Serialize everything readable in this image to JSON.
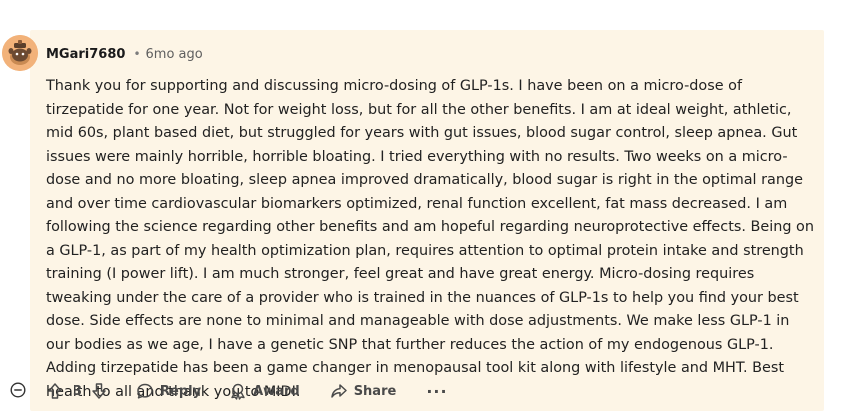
{
  "comment": {
    "username": "MGari7680",
    "separator": "•",
    "timestamp": "6mo ago",
    "body": "Thank you for supporting and discussing micro-dosing of GLP-1s. I have been on a micro-dose of tirzepatide for one year. Not for weight loss, but for all the other benefits. I am at ideal weight, athletic, mid 60s, plant based diet, but struggled for years with gut issues, blood sugar control, sleep apnea. Gut issues were mainly horrible, horrible bloating. I tried everything with no results. Two weeks on a micro-dose and no more bloating, sleep apnea improved dramatically, blood sugar is right in the optimal range and over time cardiovascular biomarkers optimized, renal function excellent, fat mass decreased. I am following the science regarding other benefits and am hopeful regarding neuroprotective effects. Being on a GLP-1, as part of my health optimization plan, requires attention to optimal protein intake and strength training (I power lift). I am much stronger, feel great and have great energy. Micro-dosing requires tweaking under the care of a provider who is trained in the nuances of GLP-1s to help you find your best dose. Side effects are none to minimal and manageable with dose adjustments. We make less GLP-1 in our bodies as we age, I have a genetic SNP that further reduces the action of my endogenous GLP-1. Adding tirzepatide has been a game changer in menopausal tool kit along with lifestyle and MHT. Best health to all and thank you to MIDI."
  },
  "actions": {
    "vote_count": "3",
    "reply_label": "Reply",
    "award_label": "Award",
    "share_label": "Share",
    "more_label": "···"
  },
  "icons": {
    "collapse": "collapse-minus-icon",
    "upvote": "upvote-arrow-icon",
    "downvote": "downvote-arrow-icon",
    "reply": "reply-speech-bubble-icon",
    "award": "award-ribbon-icon",
    "share": "share-arrow-icon",
    "avatar": "snoo-avatar-icon"
  },
  "colors": {
    "highlight_background": "#fdf5e6",
    "avatar_background": "#f2b27a",
    "text": "#222222",
    "muted": "#5f5f5f"
  }
}
